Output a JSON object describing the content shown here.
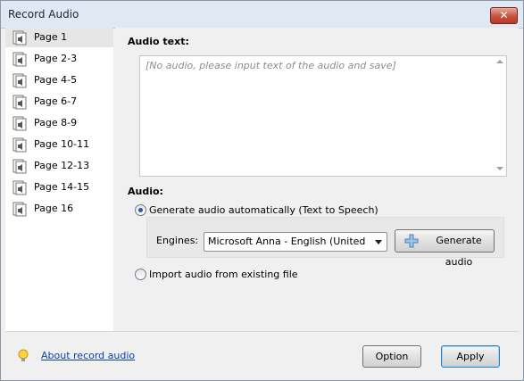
{
  "window": {
    "title": "Record Audio",
    "close_icon": "close-icon"
  },
  "sidebar": {
    "items": [
      {
        "label": "Page 1",
        "selected": true
      },
      {
        "label": "Page 2-3"
      },
      {
        "label": "Page 4-5"
      },
      {
        "label": "Page 6-7"
      },
      {
        "label": "Page 8-9"
      },
      {
        "label": "Page 10-11"
      },
      {
        "label": "Page 12-13"
      },
      {
        "label": "Page 14-15"
      },
      {
        "label": "Page 16"
      }
    ],
    "item_icon": "audio-page-icon"
  },
  "main": {
    "audio_text_label": "Audio text:",
    "audio_text_placeholder": "[No audio, please input text of the audio and save]",
    "audio_label": "Audio:",
    "radio_tts_label": "Generate audio automatically (Text to Speech)",
    "radio_tts_selected": true,
    "engines_label": "Engines:",
    "engine_selected": "Microsoft Anna - English (United States)",
    "generate_button": "Generate audio",
    "generate_icon": "plus-icon",
    "radio_import_label": "Import audio from existing file",
    "radio_import_selected": false
  },
  "footer": {
    "about_link": "About record audio",
    "bulb_icon": "lightbulb-icon",
    "option_button": "Option",
    "apply_button": "Apply"
  },
  "colors": {
    "accent": "#2c5aa0",
    "link": "#0b3fb0",
    "close": "#c9513f"
  }
}
